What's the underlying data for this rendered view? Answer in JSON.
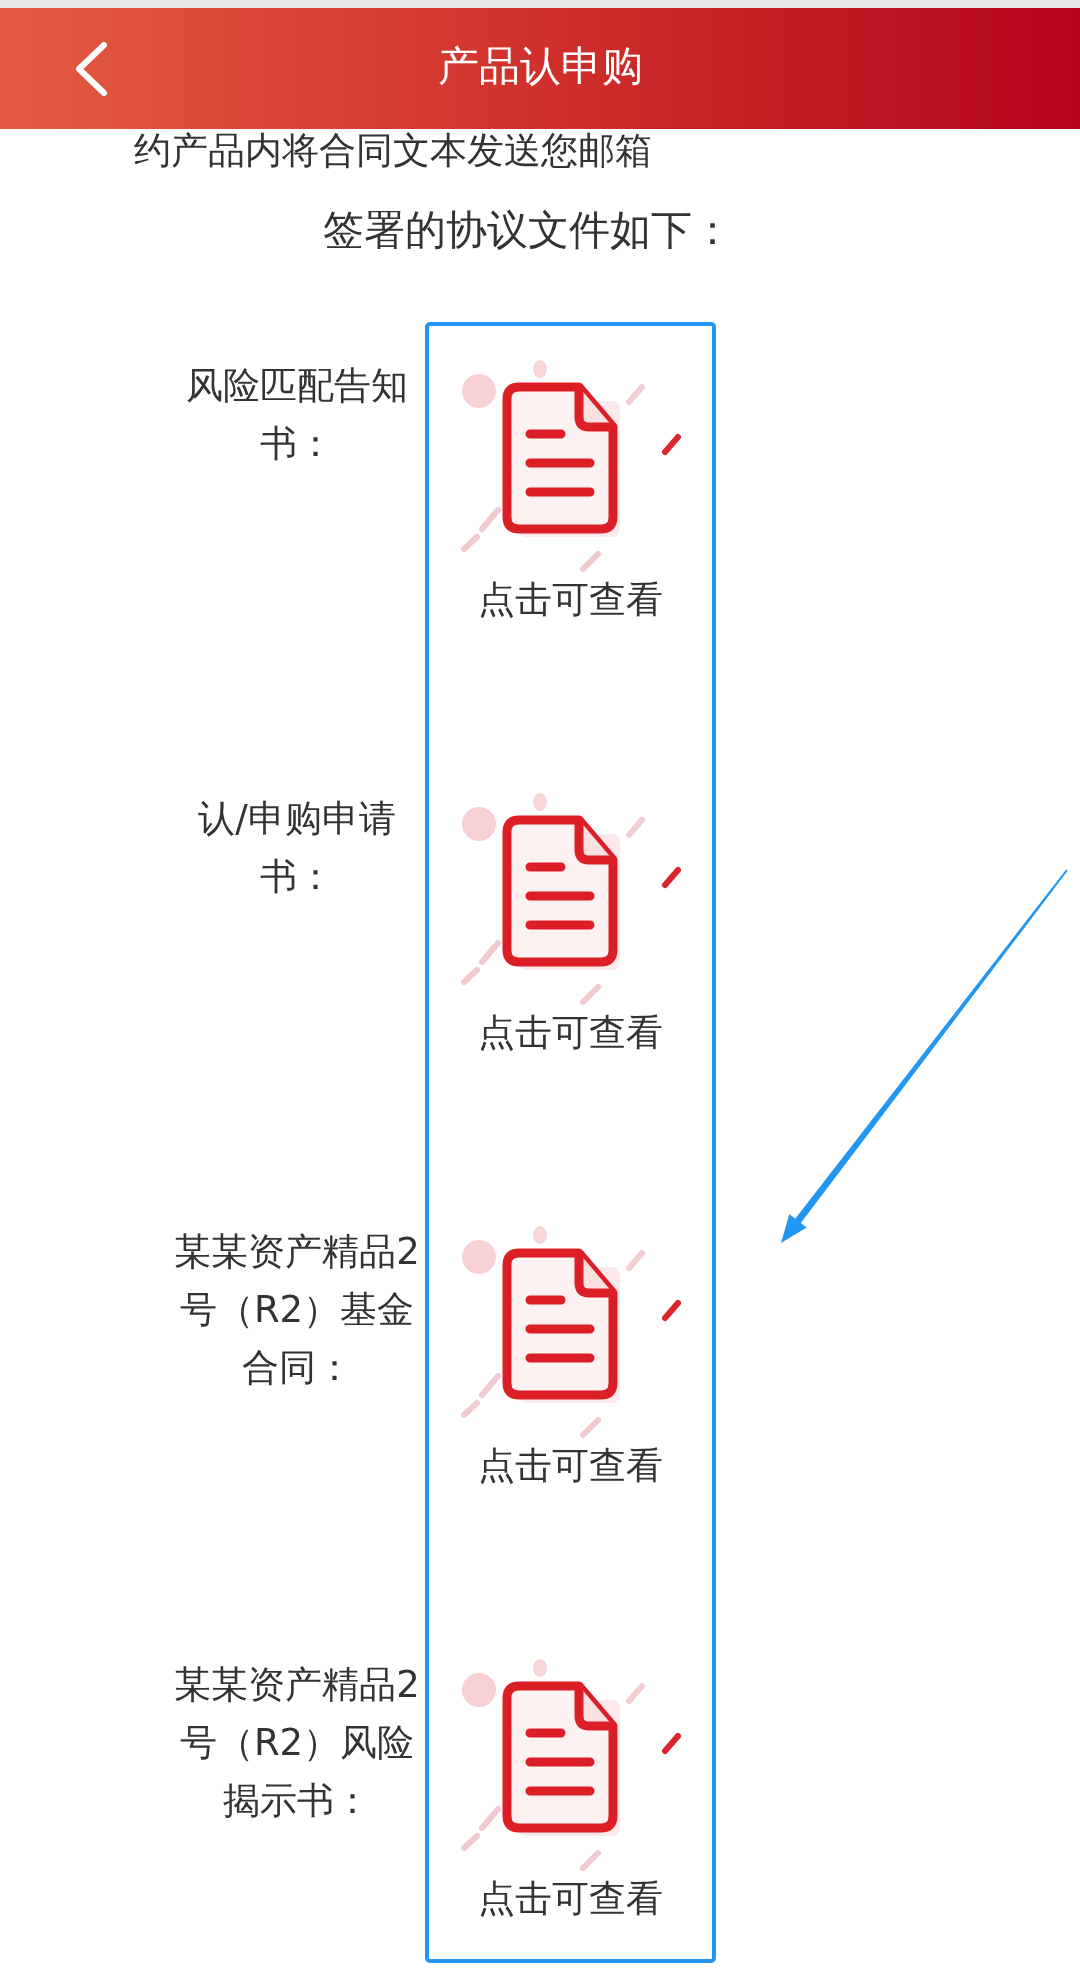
{
  "header": {
    "title": "产品认申购"
  },
  "intro_text": "约产品内将合同文本发送您邮箱",
  "section_title": "签署的协议文件如下：",
  "documents": [
    {
      "label": "风险匹配告知书：",
      "action": "点击可查看"
    },
    {
      "label": "认/申购申请书：",
      "action": "点击可查看"
    },
    {
      "label": "某某资产精品2号（R2）基金合同：",
      "action": "点击可查看"
    },
    {
      "label": "某某资产精品2号（R2）风险揭示书：",
      "action": "点击可查看"
    }
  ]
}
